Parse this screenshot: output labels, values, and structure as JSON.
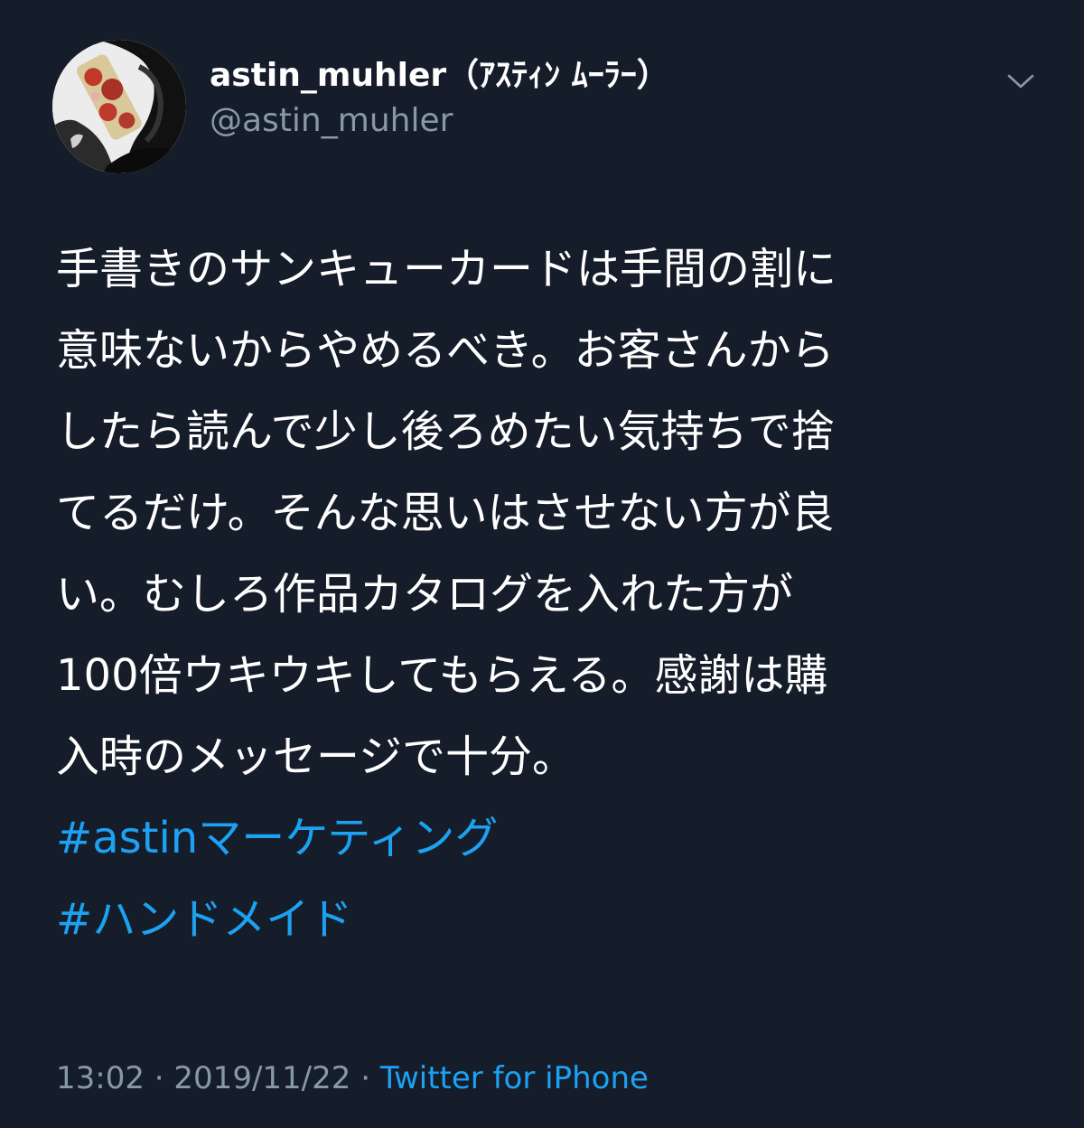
{
  "user": {
    "display_name": "astin_muhler（ｱｽﾃｨﾝ ﾑｰﾗｰ）",
    "handle": "@astin_muhler"
  },
  "tweet": {
    "lines": [
      "手書きのサンキューカードは手間の割に",
      "意味ないからやめるべき。お客さんから",
      "したら読んで少し後ろめたい気持ちで捨",
      "てるだけ。そんな思いはさせない方が良",
      "い。むしろ作品カタログを入れた方が",
      "100倍ウキウキしてもらえる。感謝は購",
      "入時のメッセージで十分。"
    ],
    "hashtags": [
      "#astinマーケティング",
      "#ハンドメイド"
    ]
  },
  "meta": {
    "time": "13:02",
    "separator": " · ",
    "date": "2019/11/22",
    "source": "Twitter for iPhone"
  },
  "icons": {
    "menu": "chevron-down-icon",
    "avatar": "profile-photo"
  },
  "colors": {
    "background": "#151d2a",
    "text": "#ffffff",
    "secondary": "#8899a6",
    "link": "#1da1f2"
  }
}
